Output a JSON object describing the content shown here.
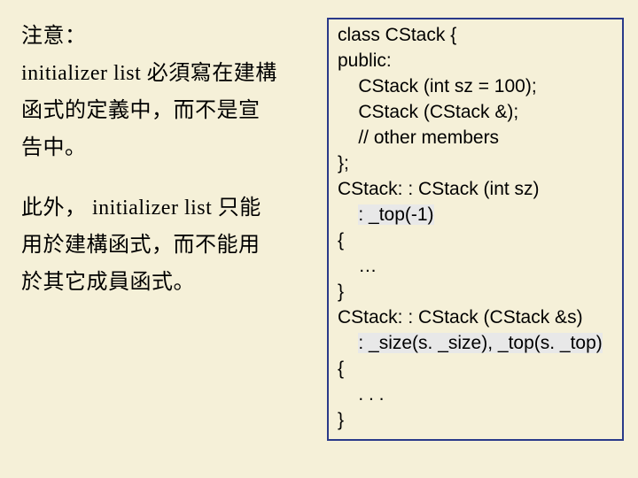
{
  "left": {
    "para1_l1": "注意：",
    "para1_l2": "initializer list 必須寫在建構",
    "para1_l3": "函式的定義中，而不是宣",
    "para1_l4": "告中。",
    "para2_l1": "此外， initializer list 只能",
    "para2_l2": "用於建構函式，而不能用",
    "para2_l3": "於其它成員函式。"
  },
  "code": {
    "l1": "class CStack {",
    "l2": "public:",
    "l3": "    CStack (int sz = 100);",
    "l4": "    CStack (CStack &);",
    "l5": "    // other members",
    "l6": "};",
    "l7": "",
    "l8": "CStack: : CStack (int sz)",
    "l9_pre": "    ",
    "l9_hl": ": _top(-1)",
    "l10": "{",
    "l11": "    …",
    "l12": "}",
    "l13": "CStack: : CStack (CStack &s)",
    "l14_pre": "    ",
    "l14_hl": ": _size(s. _size), _top(s. _top)",
    "l15": "{",
    "l16": "    . . .",
    "l17": "}"
  }
}
